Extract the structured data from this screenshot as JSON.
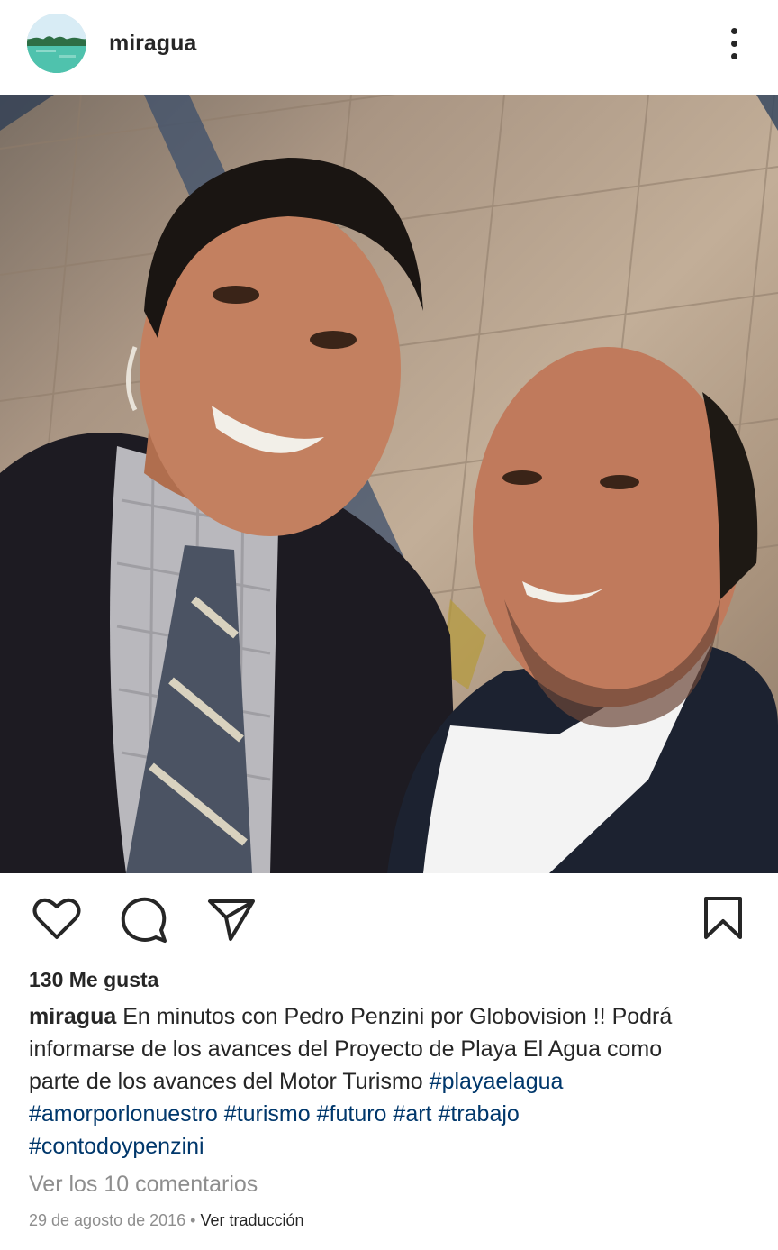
{
  "post": {
    "username": "miragua",
    "avatar_icon": "profile-avatar-icon",
    "more_icon": "more-options-icon"
  },
  "actions": {
    "like_icon": "heart-icon",
    "comment_icon": "comment-icon",
    "share_icon": "send-icon",
    "save_icon": "bookmark-icon"
  },
  "likes": "130 Me gusta",
  "caption": {
    "username": "miragua",
    "text_line1": "En minutos con Pedro Penzini por Globovision !! Podrá",
    "text_line2": "informarse de los avances del Proyecto de Playa El Agua como",
    "text_line3": "parte de los avances del Motor Turismo",
    "hashtags": [
      "#playaelagua",
      "#amorporlonuestro",
      "#turismo",
      "#futuro",
      "#art",
      "#trabajo",
      "#contodoypenzini"
    ]
  },
  "comments_link": "Ver los 10 comentarios",
  "date": "29 de agosto de 2016",
  "separator": "•",
  "translate_link": "Ver traducción",
  "colors": {
    "text": "#262626",
    "hashtag": "#00376b",
    "muted": "#8e8e8e"
  }
}
